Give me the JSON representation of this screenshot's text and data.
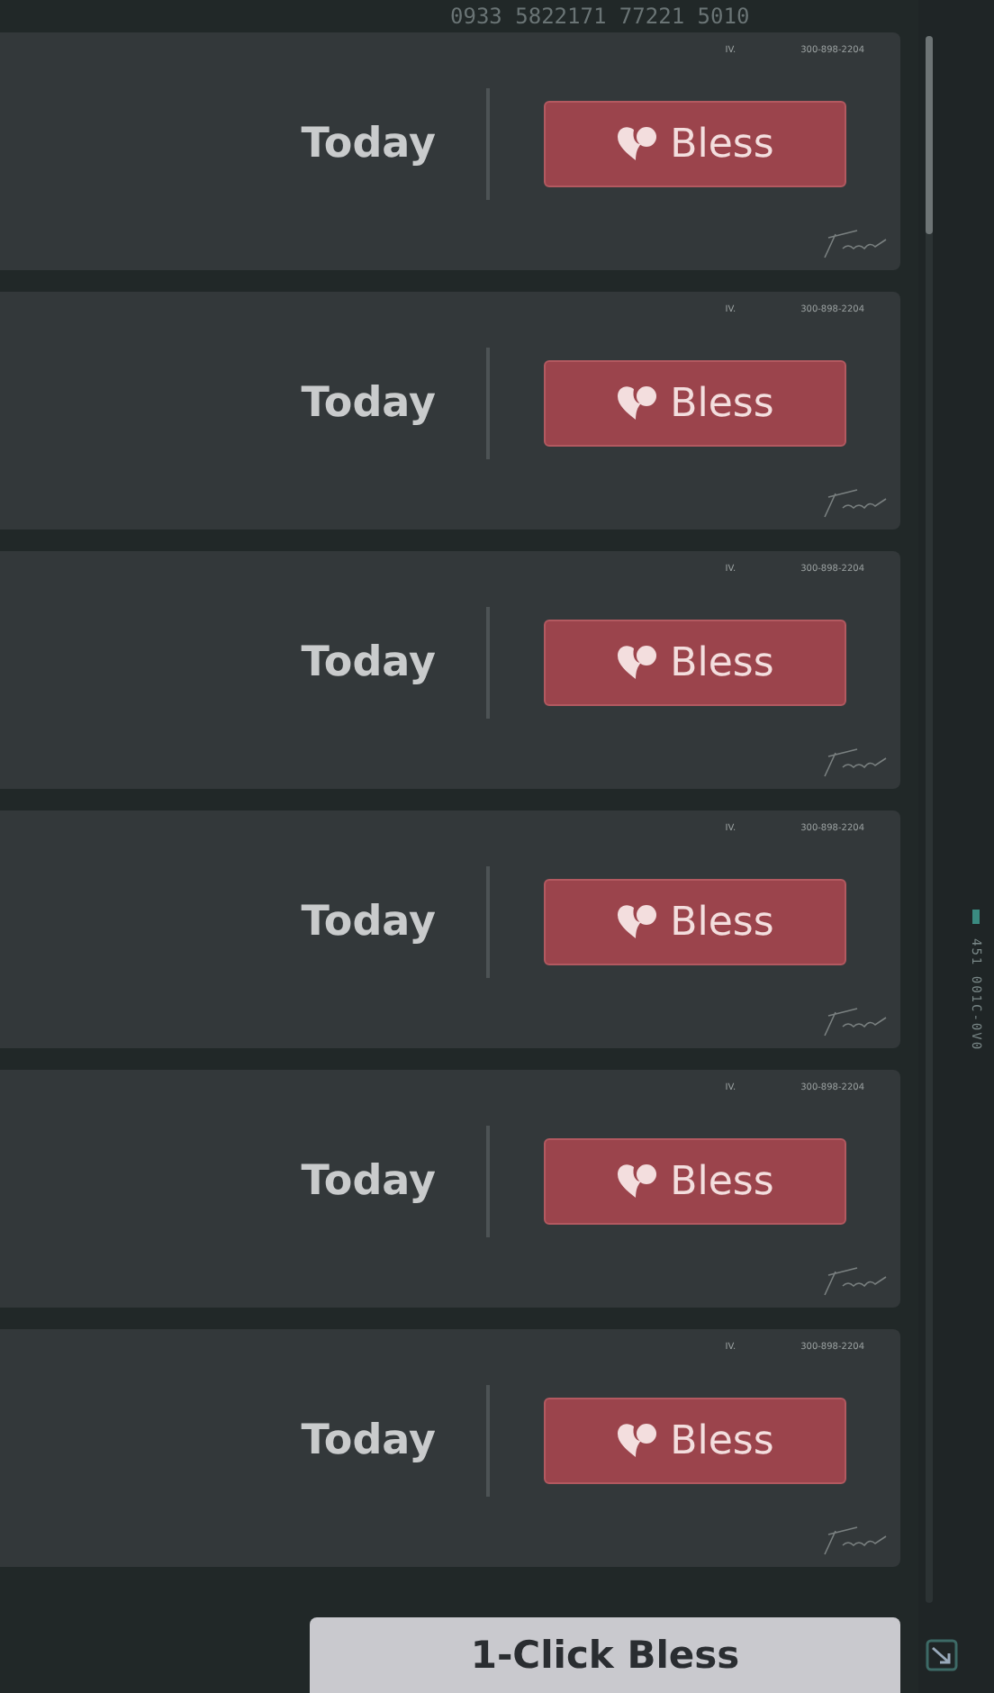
{
  "backdrop": {
    "code_line": "0933 5822171 77221 5010",
    "side_code": "451 001C-0V0"
  },
  "cards": [
    {
      "mark": "IV.",
      "number": "300-898-2204",
      "date": "Today",
      "button": "Bless"
    },
    {
      "mark": "IV.",
      "number": "300-898-2204",
      "date": "Today",
      "button": "Bless"
    },
    {
      "mark": "IV.",
      "number": "300-898-2204",
      "date": "Today",
      "button": "Bless"
    },
    {
      "mark": "IV.",
      "number": "300-898-2204",
      "date": "Today",
      "button": "Bless"
    },
    {
      "mark": "IV.",
      "number": "300-898-2204",
      "date": "Today",
      "button": "Bless"
    },
    {
      "mark": "IV.",
      "number": "300-898-2204",
      "date": "Today",
      "button": "Bless"
    }
  ],
  "footer_button": "1-Click Bless"
}
